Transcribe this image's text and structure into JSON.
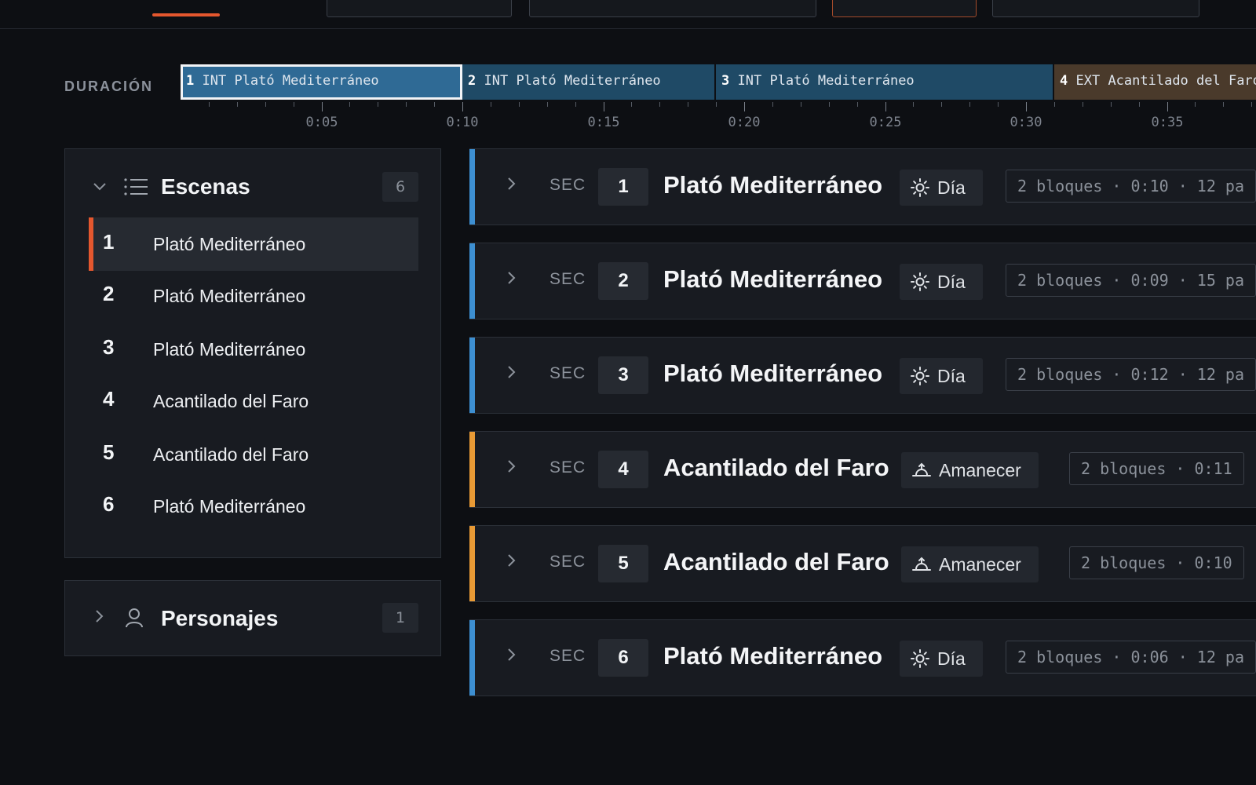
{
  "colors": {
    "accent": "#e4572e",
    "interior": "#3d8fd1",
    "exterior": "#e89a35",
    "segment_interior": "#1f4a66",
    "segment_selected": "#2f6a95",
    "segment_exterior": "#4a3a2b"
  },
  "timeline": {
    "label": "DURACIÓN",
    "segments": [
      {
        "num": "1",
        "label": "INT Plató Mediterráneo",
        "kind": "interior",
        "selected": true,
        "duration": 10
      },
      {
        "num": "2",
        "label": "INT Plató Mediterráneo",
        "kind": "interior",
        "selected": false,
        "duration": 9
      },
      {
        "num": "3",
        "label": "INT Plató Mediterráneo",
        "kind": "interior",
        "selected": false,
        "duration": 12
      },
      {
        "num": "4",
        "label": "EXT Acantilado del Faro",
        "kind": "exterior",
        "selected": false,
        "duration": 11
      }
    ],
    "ticks": [
      "0:05",
      "0:10",
      "0:15",
      "0:20",
      "0:25",
      "0:30",
      "0:35"
    ]
  },
  "scenes_panel": {
    "title": "Escenas",
    "count": "6",
    "icon": "list-icon",
    "items": [
      {
        "num": "1",
        "name": "Plató Mediterráneo",
        "active": true
      },
      {
        "num": "2",
        "name": "Plató Mediterráneo",
        "active": false
      },
      {
        "num": "3",
        "name": "Plató Mediterráneo",
        "active": false
      },
      {
        "num": "4",
        "name": "Acantilado del Faro",
        "active": false
      },
      {
        "num": "5",
        "name": "Acantilado del Faro",
        "active": false
      },
      {
        "num": "6",
        "name": "Plató Mediterráneo",
        "active": false
      }
    ]
  },
  "characters_panel": {
    "title": "Personajes",
    "count": "1",
    "icon": "person-icon"
  },
  "sequences": [
    {
      "sec_label": "SEC",
      "num": "1",
      "title": "Plató Mediterráneo",
      "kind": "interior",
      "time_of_day": "Día",
      "tod_icon": "sun-icon",
      "meta": "2 bloques · 0:10 · 12 pa"
    },
    {
      "sec_label": "SEC",
      "num": "2",
      "title": "Plató Mediterráneo",
      "kind": "interior",
      "time_of_day": "Día",
      "tod_icon": "sun-icon",
      "meta": "2 bloques · 0:09 · 15 pa"
    },
    {
      "sec_label": "SEC",
      "num": "3",
      "title": "Plató Mediterráneo",
      "kind": "interior",
      "time_of_day": "Día",
      "tod_icon": "sun-icon",
      "meta": "2 bloques · 0:12 · 12 pa"
    },
    {
      "sec_label": "SEC",
      "num": "4",
      "title": "Acantilado del Faro",
      "kind": "exterior",
      "time_of_day": "Amanecer",
      "tod_icon": "sunrise-icon",
      "meta": "2 bloques · 0:11"
    },
    {
      "sec_label": "SEC",
      "num": "5",
      "title": "Acantilado del Faro",
      "kind": "exterior",
      "time_of_day": "Amanecer",
      "tod_icon": "sunrise-icon",
      "meta": "2 bloques · 0:10"
    },
    {
      "sec_label": "SEC",
      "num": "6",
      "title": "Plató Mediterráneo",
      "kind": "interior",
      "time_of_day": "Día",
      "tod_icon": "sun-icon",
      "meta": "2 bloques · 0:06 · 12 pa"
    }
  ]
}
